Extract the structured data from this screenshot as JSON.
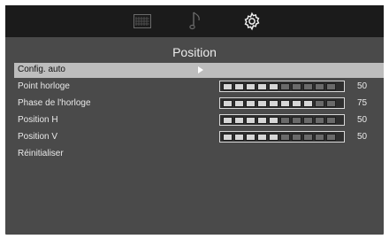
{
  "tabs": [
    {
      "name": "picture",
      "icon": "picture-icon",
      "active": false
    },
    {
      "name": "audio",
      "icon": "music-note-icon",
      "active": false
    },
    {
      "name": "settings",
      "icon": "gear-icon",
      "active": true
    }
  ],
  "page_title": "Position",
  "items": [
    {
      "label": "Config. auto",
      "selected": true
    },
    {
      "label": "Point horloge",
      "value": "50",
      "level": 0.5
    },
    {
      "label": "Phase de l'horloge",
      "value": "75",
      "level": 0.75
    },
    {
      "label": "Position H",
      "value": "50",
      "level": 0.5
    },
    {
      "label": "Position V",
      "value": "50",
      "level": 0.5
    },
    {
      "label": "Réinitialiser"
    }
  ],
  "colors": {
    "background": "#4a4a4a",
    "topbar": "#1b1b1b",
    "highlight": "#bdbdbd"
  }
}
